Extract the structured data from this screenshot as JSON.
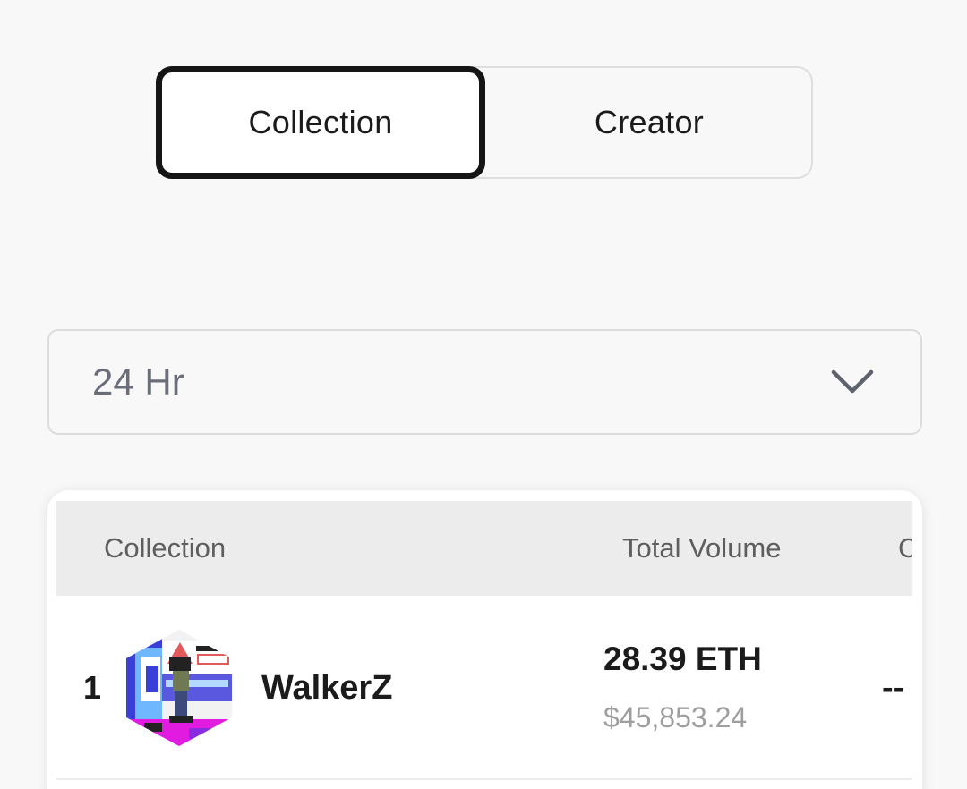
{
  "tabs": {
    "collection_label": "Collection",
    "creator_label": "Creator",
    "active": "Collection"
  },
  "period_dropdown": {
    "value": "24 Hr",
    "icon": "chevron-down-icon"
  },
  "table": {
    "headers": {
      "collection": "Collection",
      "total_volume": "Total Volume",
      "next_column_partial": "C"
    },
    "rows": [
      {
        "rank": "1",
        "avatar": "walkerz-pixel-avatar",
        "name": "WalkerZ",
        "volume_eth": "28.39 ETH",
        "volume_usd": "$45,853.24",
        "next_column_partial": "--"
      }
    ]
  }
}
